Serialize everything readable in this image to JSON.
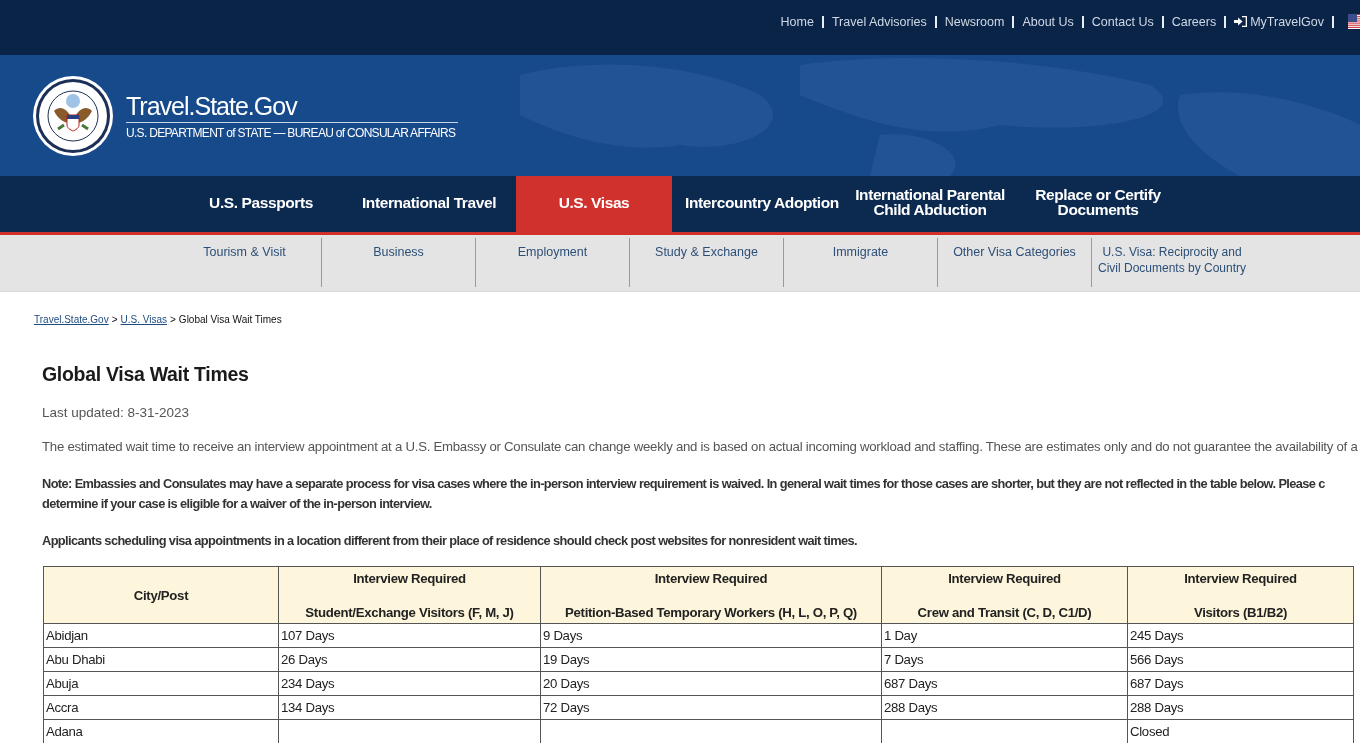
{
  "top_links": [
    {
      "label": "Home",
      "kind": "text"
    },
    {
      "label": "Travel Advisories",
      "kind": "text"
    },
    {
      "label": "Newsroom",
      "kind": "text"
    },
    {
      "label": "About Us",
      "kind": "text"
    },
    {
      "label": "Contact Us",
      "kind": "text"
    },
    {
      "label": "Careers",
      "kind": "text"
    },
    {
      "label": "MyTravelGov",
      "kind": "login"
    }
  ],
  "banner": {
    "title": "Travel.State.Gov",
    "subtitle": "U.S. DEPARTMENT of STATE — BUREAU of CONSULAR AFFAIRS"
  },
  "nav": [
    {
      "lines": [
        "U.S. Passports"
      ],
      "selected": false
    },
    {
      "lines": [
        "International Travel"
      ],
      "selected": false
    },
    {
      "lines": [
        "U.S. Visas"
      ],
      "selected": true
    },
    {
      "lines": [
        "Intercountry Adoption"
      ],
      "selected": false
    },
    {
      "lines": [
        "International Parental",
        "Child Abduction"
      ],
      "selected": false
    },
    {
      "lines": [
        "Replace or Certify",
        "Documents"
      ],
      "selected": false
    }
  ],
  "subnav": [
    {
      "label": "Tourism & Visit"
    },
    {
      "label": "Business"
    },
    {
      "label": "Employment"
    },
    {
      "label": "Study & Exchange"
    },
    {
      "label": "Immigrate"
    },
    {
      "label": "Other Visa Categories"
    },
    {
      "label": "U.S. Visa: Reciprocity and Civil Documents by Country"
    }
  ],
  "breadcrumb": [
    {
      "label": "Travel.State.Gov",
      "kind": "link"
    },
    {
      "label": ">",
      "kind": "separator"
    },
    {
      "label": "U.S. Visas",
      "kind": "link"
    },
    {
      "label": ">",
      "kind": "separator"
    },
    {
      "label": "Global Visa Wait Times",
      "kind": "current"
    }
  ],
  "title": "Global Visa Wait Times",
  "last_updated": "Last updated: 8-31-2023",
  "paragraphs": [
    {
      "kind": "normal",
      "lines": [
        "The estimated wait time to receive an interview appointment at a U.S. Embassy or Consulate can change weekly and is based on actual incoming workload and staffing. These are estimates only and do not guarantee the availability of a"
      ]
    },
    {
      "kind": "bold",
      "lines": [
        "Note: Embassies and Consulates may have a separate process for visa cases where the in-person interview requirement is waived.  In general wait times for those cases are shorter, but they are not reflected in the table below.  Please c",
        "determine if your case is eligible for a waiver of the in-person interview."
      ]
    },
    {
      "kind": "bold",
      "lines": [
        "Applicants scheduling visa appointments in a location different from their place of residence should check post websites for nonresident wait times."
      ]
    }
  ],
  "table": {
    "columns": [
      {
        "lines": [
          "City/Post"
        ]
      },
      {
        "lines": [
          "Interview Required",
          "Student/Exchange Visitors (F, M, J)"
        ]
      },
      {
        "lines": [
          "Interview Required",
          "Petition-Based Temporary Workers (H, L, O, P, Q)"
        ]
      },
      {
        "lines": [
          "Interview Required",
          "Crew and Transit (C, D, C1/D)"
        ]
      },
      {
        "lines": [
          "Interview Required",
          "Visitors (B1/B2)"
        ]
      }
    ],
    "rows": [
      [
        "Abidjan",
        "107 Days",
        "9 Days",
        "1 Day",
        "245 Days"
      ],
      [
        "Abu Dhabi",
        "26 Days",
        "19 Days",
        "7 Days",
        "566 Days"
      ],
      [
        "Abuja",
        "234 Days",
        "20 Days",
        "687 Days",
        "687 Days"
      ],
      [
        "Accra",
        "134 Days",
        "72 Days",
        "288 Days",
        "288 Days"
      ],
      [
        "Adana",
        "",
        "",
        "",
        "Closed"
      ]
    ]
  }
}
